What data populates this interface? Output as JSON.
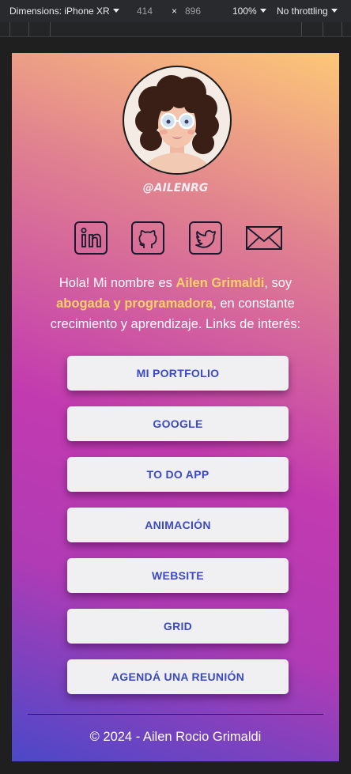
{
  "devtools": {
    "dimensions_label": "Dimensions: iPhone XR",
    "width": "414",
    "times": "×",
    "height": "896",
    "zoom": "100%",
    "throttling": "No throttling"
  },
  "profile": {
    "handle": "@AILENRG"
  },
  "social": [
    {
      "icon": "linkedin-icon"
    },
    {
      "icon": "github-icon"
    },
    {
      "icon": "twitter-icon"
    },
    {
      "icon": "mail-icon"
    }
  ],
  "intro": {
    "part1": "Hola! Mi nombre es ",
    "name": "Ailen Grimaldi",
    "part2": ", soy ",
    "role": "abogada y programadora",
    "part3": ", en constante crecimiento y aprendizaje. Links de interés:"
  },
  "links": [
    {
      "label": "MI PORTFOLIO"
    },
    {
      "label": "GOOGLE"
    },
    {
      "label": "TO DO APP"
    },
    {
      "label": "ANIMACIÓN"
    },
    {
      "label": "WEBSITE"
    },
    {
      "label": "GRID"
    },
    {
      "label": "AGENDÁ UNA REUNIÓN"
    }
  ],
  "footer": {
    "text": "© 2024 - Ailen Rocio Grimaldi"
  },
  "colors": {
    "highlight": "#ffd166",
    "button_text": "#3b49c4",
    "button_bg": "#f0f0f2"
  }
}
